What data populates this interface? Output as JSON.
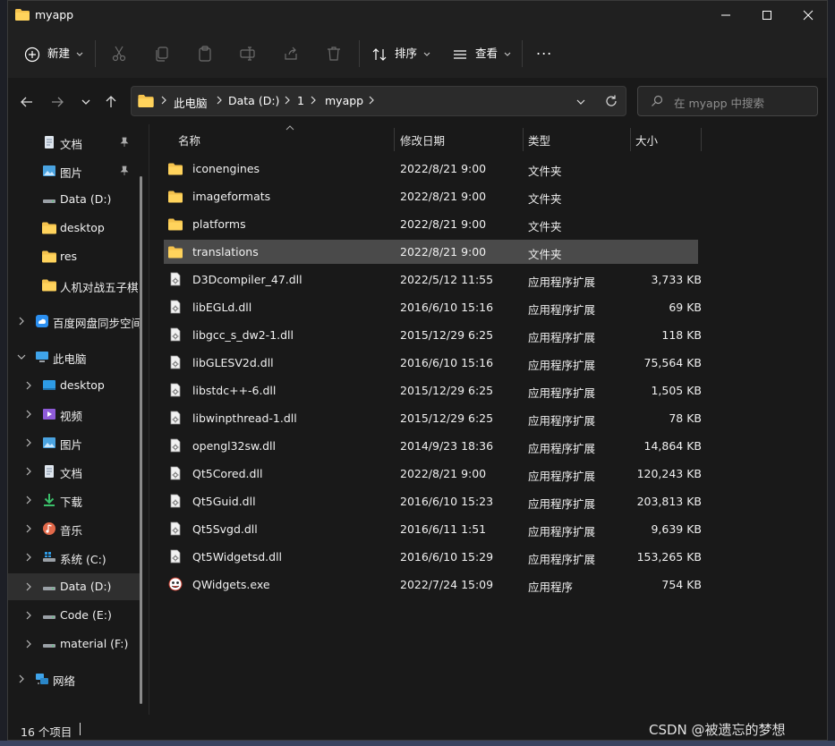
{
  "window": {
    "title": "myapp"
  },
  "toolbar": {
    "new_label": "新建",
    "sort_label": "排序",
    "view_label": "查看",
    "more_label": "..."
  },
  "address": {
    "crumbs": [
      "此电脑",
      "Data (D:)",
      "1",
      "myapp"
    ]
  },
  "search": {
    "placeholder": "在 myapp 中搜索"
  },
  "sidebar": {
    "items": [
      {
        "label": "文档",
        "icon": "documents-icon"
      },
      {
        "label": "图片",
        "icon": "pictures-icon"
      },
      {
        "label": "Data (D:)",
        "icon": "drive-icon"
      },
      {
        "label": "desktop",
        "icon": "folder-icon"
      },
      {
        "label": "res",
        "icon": "folder-icon"
      },
      {
        "label": "人机对战五子棋",
        "icon": "folder-icon"
      },
      {
        "label": "百度网盘同步空间",
        "icon": "cloud-icon"
      },
      {
        "label": "此电脑",
        "icon": "computer-icon"
      },
      {
        "label": "desktop",
        "icon": "desktop-icon"
      },
      {
        "label": "视频",
        "icon": "video-icon"
      },
      {
        "label": "图片",
        "icon": "pictures-icon"
      },
      {
        "label": "文档",
        "icon": "documents-icon"
      },
      {
        "label": "下载",
        "icon": "download-icon"
      },
      {
        "label": "音乐",
        "icon": "music-icon"
      },
      {
        "label": "系统 (C:)",
        "icon": "system-drive-icon"
      },
      {
        "label": "Data (D:)",
        "icon": "drive-icon"
      },
      {
        "label": "Code (E:)",
        "icon": "drive-icon"
      },
      {
        "label": "material (F:)",
        "icon": "drive-icon"
      },
      {
        "label": "网络",
        "icon": "network-icon"
      }
    ]
  },
  "columns": {
    "name": "名称",
    "date": "修改日期",
    "type": "类型",
    "size": "大小"
  },
  "files": [
    {
      "name": "iconengines",
      "date": "2022/8/21 9:00",
      "type": "文件夹",
      "size": "",
      "kind": "folder"
    },
    {
      "name": "imageformats",
      "date": "2022/8/21 9:00",
      "type": "文件夹",
      "size": "",
      "kind": "folder"
    },
    {
      "name": "platforms",
      "date": "2022/8/21 9:00",
      "type": "文件夹",
      "size": "",
      "kind": "folder"
    },
    {
      "name": "translations",
      "date": "2022/8/21 9:00",
      "type": "文件夹",
      "size": "",
      "kind": "folder"
    },
    {
      "name": "D3Dcompiler_47.dll",
      "date": "2022/5/12 11:55",
      "type": "应用程序扩展",
      "size": "3,733 KB",
      "kind": "dll"
    },
    {
      "name": "libEGLd.dll",
      "date": "2016/6/10 15:16",
      "type": "应用程序扩展",
      "size": "69 KB",
      "kind": "dll"
    },
    {
      "name": "libgcc_s_dw2-1.dll",
      "date": "2015/12/29 6:25",
      "type": "应用程序扩展",
      "size": "118 KB",
      "kind": "dll"
    },
    {
      "name": "libGLESV2d.dll",
      "date": "2016/6/10 15:16",
      "type": "应用程序扩展",
      "size": "75,564 KB",
      "kind": "dll"
    },
    {
      "name": "libstdc++-6.dll",
      "date": "2015/12/29 6:25",
      "type": "应用程序扩展",
      "size": "1,505 KB",
      "kind": "dll"
    },
    {
      "name": "libwinpthread-1.dll",
      "date": "2015/12/29 6:25",
      "type": "应用程序扩展",
      "size": "78 KB",
      "kind": "dll"
    },
    {
      "name": "opengl32sw.dll",
      "date": "2014/9/23 18:36",
      "type": "应用程序扩展",
      "size": "14,864 KB",
      "kind": "dll"
    },
    {
      "name": "Qt5Cored.dll",
      "date": "2022/8/21 9:00",
      "type": "应用程序扩展",
      "size": "120,243 KB",
      "kind": "dll"
    },
    {
      "name": "Qt5Guid.dll",
      "date": "2016/6/10 15:23",
      "type": "应用程序扩展",
      "size": "203,813 KB",
      "kind": "dll"
    },
    {
      "name": "Qt5Svgd.dll",
      "date": "2016/6/11 1:51",
      "type": "应用程序扩展",
      "size": "9,639 KB",
      "kind": "dll"
    },
    {
      "name": "Qt5Widgetsd.dll",
      "date": "2016/6/10 15:29",
      "type": "应用程序扩展",
      "size": "153,265 KB",
      "kind": "dll"
    },
    {
      "name": "QWidgets.exe",
      "date": "2022/7/24 15:09",
      "type": "应用程序",
      "size": "754 KB",
      "kind": "exe"
    }
  ],
  "status": {
    "count_text": "16 个项目"
  },
  "watermark": "CSDN @被遗忘的梦想"
}
